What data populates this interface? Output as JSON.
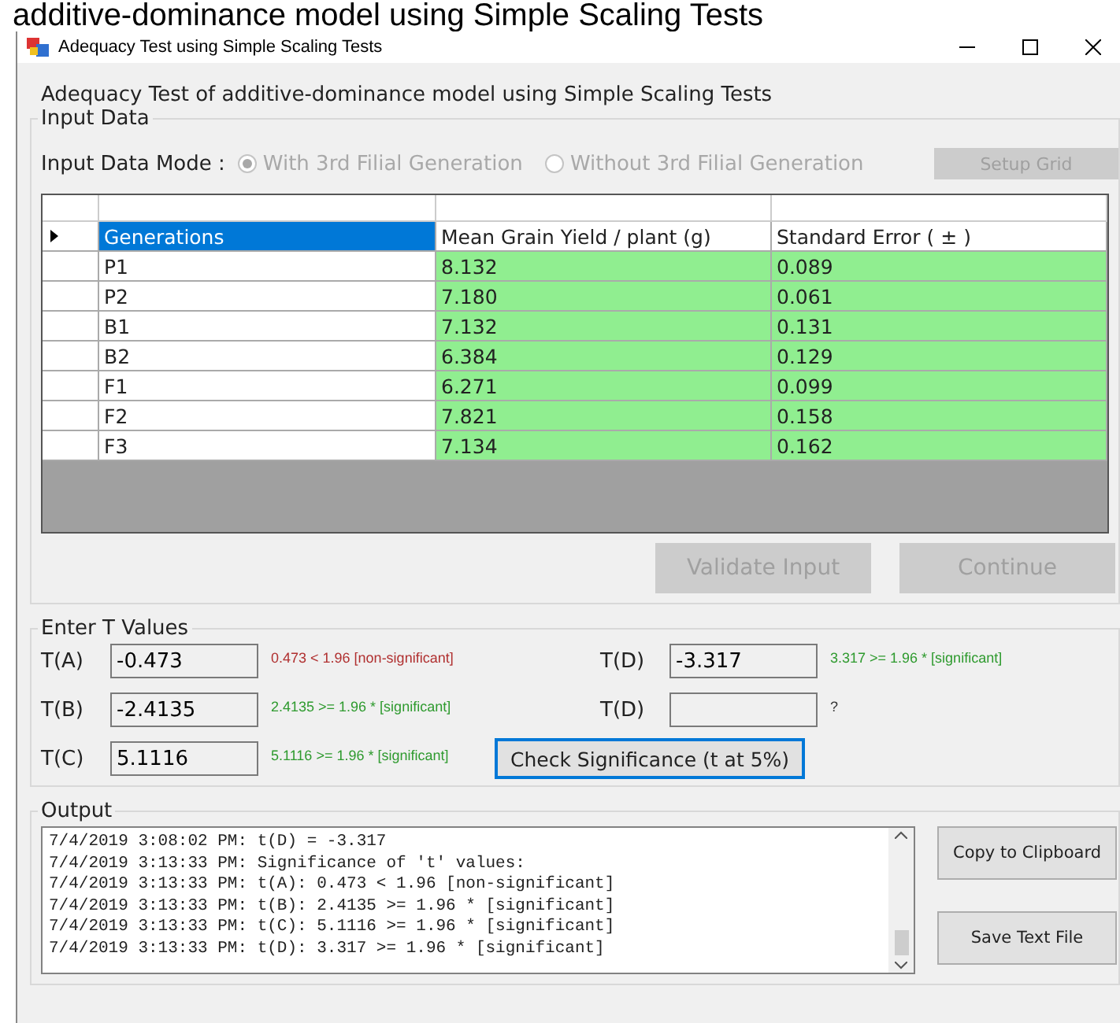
{
  "caption": "additive-dominance model using Simple Scaling Tests",
  "window": {
    "title": "Adequacy Test using Simple Scaling Tests"
  },
  "heading": "Adequacy Test of additive-dominance model using Simple Scaling Tests",
  "input_data": {
    "legend": "Input Data",
    "mode_label": "Input Data Mode :",
    "modes": [
      {
        "label": "With 3rd Filial Generation",
        "selected": true,
        "disabled": true
      },
      {
        "label": "Without 3rd Filial Generation",
        "selected": false,
        "disabled": true
      }
    ],
    "setup_button": {
      "label": "Setup Grid",
      "disabled": true
    },
    "grid": {
      "rows": [
        {
          "current": true,
          "cells": [
            {
              "text": "Generations",
              "selected": true,
              "highlighted": false
            },
            {
              "text": "Mean Grain Yield / plant (g)",
              "selected": false,
              "highlighted": false
            },
            {
              "text": "Standard Error ( ± )",
              "selected": false,
              "highlighted": false
            }
          ]
        },
        {
          "current": false,
          "cells": [
            {
              "text": "P1",
              "selected": false,
              "highlighted": false
            },
            {
              "text": "8.132",
              "selected": false,
              "highlighted": true
            },
            {
              "text": "0.089",
              "selected": false,
              "highlighted": true
            }
          ]
        },
        {
          "current": false,
          "cells": [
            {
              "text": "P2",
              "selected": false,
              "highlighted": false
            },
            {
              "text": "7.180",
              "selected": false,
              "highlighted": true
            },
            {
              "text": "0.061",
              "selected": false,
              "highlighted": true
            }
          ]
        },
        {
          "current": false,
          "cells": [
            {
              "text": "B1",
              "selected": false,
              "highlighted": false
            },
            {
              "text": "7.132",
              "selected": false,
              "highlighted": true
            },
            {
              "text": "0.131",
              "selected": false,
              "highlighted": true
            }
          ]
        },
        {
          "current": false,
          "cells": [
            {
              "text": "B2",
              "selected": false,
              "highlighted": false
            },
            {
              "text": "6.384",
              "selected": false,
              "highlighted": true
            },
            {
              "text": "0.129",
              "selected": false,
              "highlighted": true
            }
          ]
        },
        {
          "current": false,
          "cells": [
            {
              "text": "F1",
              "selected": false,
              "highlighted": false
            },
            {
              "text": "6.271",
              "selected": false,
              "highlighted": true
            },
            {
              "text": "0.099",
              "selected": false,
              "highlighted": true
            }
          ]
        },
        {
          "current": false,
          "cells": [
            {
              "text": "F2",
              "selected": false,
              "highlighted": false
            },
            {
              "text": "7.821",
              "selected": false,
              "highlighted": true
            },
            {
              "text": "0.158",
              "selected": false,
              "highlighted": true
            }
          ]
        },
        {
          "current": false,
          "cells": [
            {
              "text": "F3",
              "selected": false,
              "highlighted": false
            },
            {
              "text": "7.134",
              "selected": false,
              "highlighted": true
            },
            {
              "text": "0.162",
              "selected": false,
              "highlighted": true
            }
          ]
        }
      ]
    },
    "buttons": [
      {
        "label": "Validate Input",
        "disabled": true
      },
      {
        "label": "Continue",
        "disabled": true
      }
    ]
  },
  "t_values": {
    "legend": "Enter T Values",
    "left": [
      {
        "label": "T(A)",
        "value": "-0.473",
        "result": "0.473 < 1.96 [non-significant]",
        "color": "#b03030"
      },
      {
        "label": "T(B)",
        "value": "-2.4135",
        "result": "2.4135 >= 1.96 * [significant]",
        "color": "#2e9a2e"
      },
      {
        "label": "T(C)",
        "value": "5.1116",
        "result": "5.1116 >= 1.96 * [significant]",
        "color": "#2e9a2e"
      }
    ],
    "right": [
      {
        "label": "T(D)",
        "value": "-3.317",
        "result": "3.317 >= 1.96 * [significant]",
        "color": "#2e9a2e"
      },
      {
        "label": "T(D)",
        "result": "?",
        "color": "#333333"
      }
    ],
    "check_button": {
      "label": "Check Significance (t at 5%)",
      "focused": true
    }
  },
  "output": {
    "legend": "Output",
    "lines": [
      "7/4/2019 3:08:02 PM: t(D) = -3.317",
      "7/4/2019 3:13:33 PM: Significance of 't' values:",
      "7/4/2019 3:13:33 PM: t(A): 0.473 < 1.96 [non-significant]",
      "7/4/2019 3:13:33 PM: t(B): 2.4135 >= 1.96 * [significant]",
      "7/4/2019 3:13:33 PM: t(C): 5.1116 >= 1.96 * [significant]",
      "7/4/2019 3:13:33 PM: t(D): 3.317 >= 1.96 * [significant]"
    ],
    "buttons": [
      {
        "label": "Copy to Clipboard"
      },
      {
        "label": "Save Text File"
      }
    ]
  }
}
